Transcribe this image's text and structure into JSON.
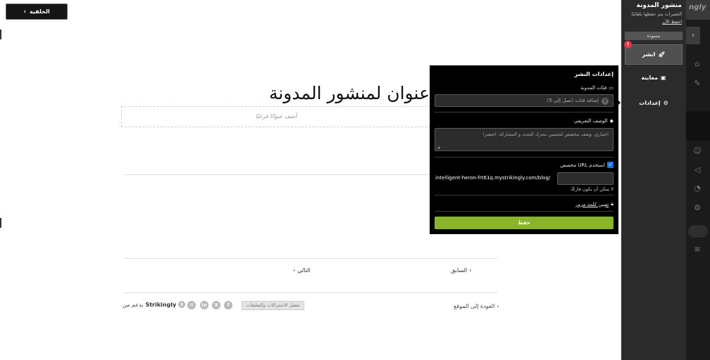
{
  "canvas": {
    "back_label": "الخلفية",
    "post_title": "عنوان لمنشور المدونة",
    "subtitle_placeholder": "أضف عنوانًا فرعيًا",
    "prev_label": "السابق",
    "next_label": "التالي",
    "back_to_site": "العودة إلى الموقع",
    "subscriptions_button": "تفعيل الاشتراكات والتعليقات",
    "powered_by_prefix": "يدعم من",
    "powered_by_brand": "Strikingly"
  },
  "publish_popover": {
    "title": "إعدادات النشر",
    "categories_label": "فئات المدونة",
    "categories_placeholder": "إضافة فئات (تصل إلى 5)",
    "description_label": "الوصف التعريفي",
    "description_placeholder": "اختياري. وصف مخصص لتحسين محرك البحث و المشاركة. اختصر!",
    "custom_url_label": "استخدم URL مخصص",
    "custom_url_checked": true,
    "custom_url_prefix": "intelligent-heron-frt61q.mystrikingly.com/blog/",
    "custom_url_value": "",
    "custom_url_error": "لا يمكن أن يكون فارغًا.",
    "password_label": "تعيين كلمة مرور",
    "save_label": "حفظ"
  },
  "settings_panel": {
    "title": "منشور المدونة",
    "autosave_note": "التغييرات يتم حفظها تلقائيًا.",
    "save_now_link": "احفظ الآن",
    "draft_badge": "مسودة",
    "publish_label": "انشر",
    "alert_badge": "!",
    "preview_label": "معاينة",
    "settings_label": "إعدادات"
  },
  "rail": {
    "brand_fragment": "ngly"
  },
  "colors": {
    "save_button": "#8ab42a",
    "alert": "#e0364a",
    "panel_bg": "#2b2b2b",
    "checkbox": "#1a73e8"
  },
  "icons": [
    "chevron-right-icon",
    "folder-icon",
    "help-icon",
    "tag-icon",
    "lock-icon",
    "rocket-icon",
    "preview-icon",
    "gear-icon",
    "facebook-icon",
    "x-icon",
    "linkedin-icon",
    "email-icon",
    "strikingly-icon"
  ]
}
